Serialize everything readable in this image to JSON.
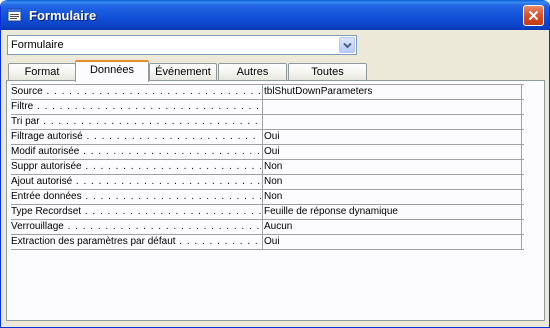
{
  "window": {
    "title": "Formulaire",
    "close_icon": "close-icon",
    "title_icon": "properties-icon"
  },
  "object_selector": {
    "value": "Formulaire",
    "icon": "chevron-down-icon"
  },
  "tabs": [
    {
      "label": "Format",
      "active": false
    },
    {
      "label": "Données",
      "active": true
    },
    {
      "label": "Événement",
      "active": false
    },
    {
      "label": "Autres",
      "active": false
    },
    {
      "label": "Toutes",
      "active": false
    }
  ],
  "properties": [
    {
      "label": "Source",
      "value": "tblShutDownParameters"
    },
    {
      "label": "Filtre",
      "value": ""
    },
    {
      "label": "Tri par",
      "value": ""
    },
    {
      "label": "Filtrage autorisé",
      "value": "Oui"
    },
    {
      "label": "Modif autorisée",
      "value": "Oui"
    },
    {
      "label": "Suppr autorisée",
      "value": "Non"
    },
    {
      "label": "Ajout autorisé",
      "value": "Non"
    },
    {
      "label": "Entrée données",
      "value": "Non"
    },
    {
      "label": "Type Recordset",
      "value": "Feuille de réponse dynamique"
    },
    {
      "label": "Verrouillage",
      "value": "Aucun"
    },
    {
      "label": "Extraction des paramètres par défaut",
      "value": "Oui"
    }
  ],
  "colors": {
    "titlebar": "#0b4fd6",
    "window_bg": "#ece9d8",
    "active_tab_accent": "#e68b2c"
  }
}
